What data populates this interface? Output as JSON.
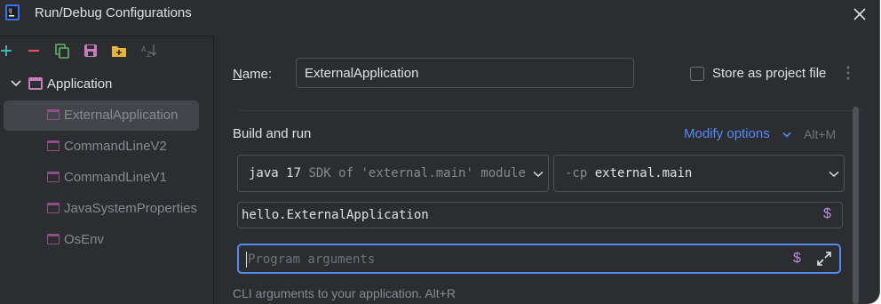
{
  "window": {
    "title": "Run/Debug Configurations"
  },
  "toolbar": {
    "add": "+",
    "remove": "−",
    "sort": "AZ"
  },
  "tree": {
    "group_label": "Application",
    "items": [
      {
        "label": "ExternalApplication"
      },
      {
        "label": "CommandLineV2"
      },
      {
        "label": "CommandLineV1"
      },
      {
        "label": "JavaSystemProperties"
      },
      {
        "label": "OsEnv"
      }
    ]
  },
  "form": {
    "name_label_mnemonic": "N",
    "name_label_rest": "ame:",
    "name_value": "ExternalApplication",
    "store_label": "Store as project file",
    "store_checked": false,
    "section_title": "Build and run",
    "modify_label": "Modify options",
    "modify_shortcut": "Alt+M",
    "jdk_prefix": "java 17",
    "jdk_suffix": "SDK of 'external.main' module",
    "cp_flag": "-cp",
    "cp_value": "external.main",
    "main_class": "hello.ExternalApplication",
    "macro_symbol": "$",
    "args_placeholder": "Program arguments",
    "args_value": "",
    "hint": "CLI arguments to your application. Alt+R"
  },
  "colors": {
    "background": "#2b2d30",
    "accent": "#548af7",
    "macro": "#b78de0",
    "config_icon": "#c77dbb"
  }
}
